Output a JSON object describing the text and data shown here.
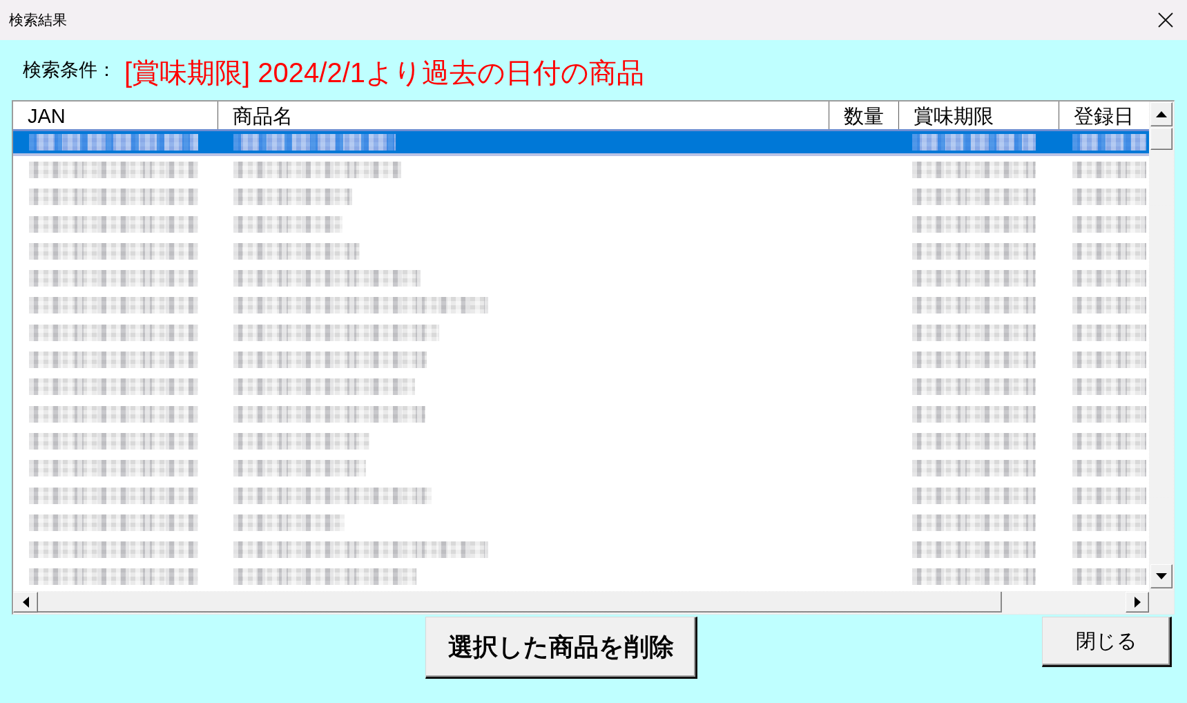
{
  "window": {
    "title": "検索結果"
  },
  "search_condition": {
    "label": "検索条件：",
    "value": "[賞味期限] 2024/2/1より過去の日付の商品"
  },
  "list": {
    "columns": [
      {
        "label": "JAN",
        "redacted": true
      },
      {
        "label": "商品名",
        "redacted": true
      },
      {
        "label": "数量",
        "redacted": false
      },
      {
        "label": "賞味期限",
        "redacted": true
      },
      {
        "label": "登録日",
        "redacted": true
      }
    ],
    "rows": [
      {
        "selected": true
      },
      {
        "selected": false
      },
      {
        "selected": false
      },
      {
        "selected": false
      },
      {
        "selected": false
      },
      {
        "selected": false
      },
      {
        "selected": false
      },
      {
        "selected": false
      },
      {
        "selected": false
      },
      {
        "selected": false
      },
      {
        "selected": false
      },
      {
        "selected": false
      },
      {
        "selected": false
      },
      {
        "selected": false
      },
      {
        "selected": false
      },
      {
        "selected": false
      },
      {
        "selected": false
      }
    ]
  },
  "delete_button": {
    "label": "選択した商品を削除"
  },
  "close_button": {
    "label": "閉じる"
  }
}
